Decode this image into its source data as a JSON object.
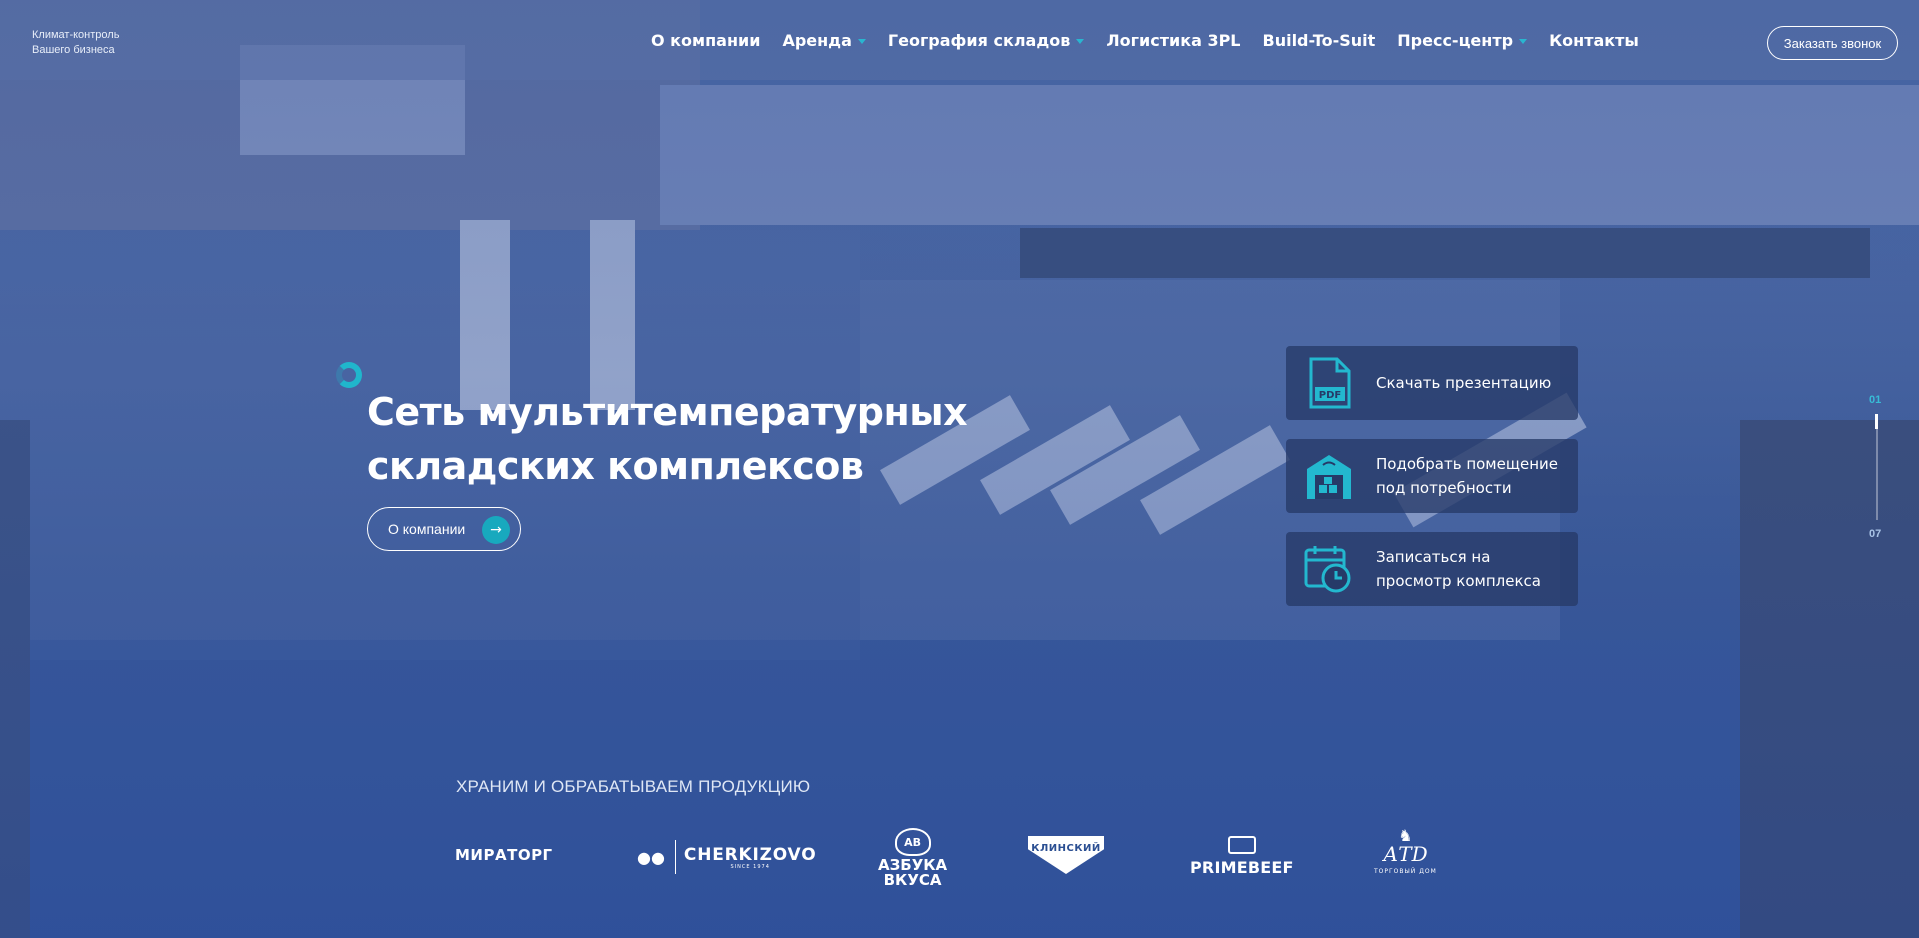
{
  "header": {
    "tagline": [
      "Климат-контроль",
      "Вашего бизнеса"
    ],
    "nav": [
      {
        "label": "О компании",
        "has_dropdown": false
      },
      {
        "label": "Аренда",
        "has_dropdown": true
      },
      {
        "label": "География складов",
        "has_dropdown": true
      },
      {
        "label": "Логистика 3PL",
        "has_dropdown": false
      },
      {
        "label": "Build-To-Suit",
        "has_dropdown": false
      },
      {
        "label": "Пресс-центр",
        "has_dropdown": true
      },
      {
        "label": "Контакты",
        "has_dropdown": false
      }
    ],
    "callback_label": "Заказать звонок"
  },
  "hero": {
    "headline_lines": [
      "Сеть мультитемпературных",
      "складских комплексов"
    ],
    "about_button_label": "О компании",
    "arrow_icon": "arrow-right-icon"
  },
  "actions": [
    {
      "icon": "pdf-file-icon",
      "label": "Скачать презентацию"
    },
    {
      "icon": "warehouse-icon",
      "label": "Подобрать помещение под потребности"
    },
    {
      "icon": "calendar-clock-icon",
      "label": "Записаться на просмотр комплекса"
    }
  ],
  "pager": {
    "current": "01",
    "total": "07",
    "progress": 0.14
  },
  "clients": {
    "title": "ХРАНИМ И ОБРАБАТЫВАЕМ ПРОДУКЦИЮ",
    "logos": {
      "miratorg": "МИРАТОРГ",
      "cherkizovo": "CHERKIZOVO",
      "cherkizovo_sub": "SINCE 1974",
      "azbuka_badge": "АВ",
      "azbuka_line1": "АЗБУКА",
      "azbuka_line2": "ВКУСА",
      "klinsky": "КЛИНСКИЙ",
      "primebeef": "PRIMEBEEF",
      "atd_mark": "АТD",
      "atd_sub": "ТОРГОВЫЙ ДОМ"
    }
  },
  "colors": {
    "accent": "#20b6cc",
    "card_bg": "#263a68",
    "overlay": "#2c4f90"
  }
}
